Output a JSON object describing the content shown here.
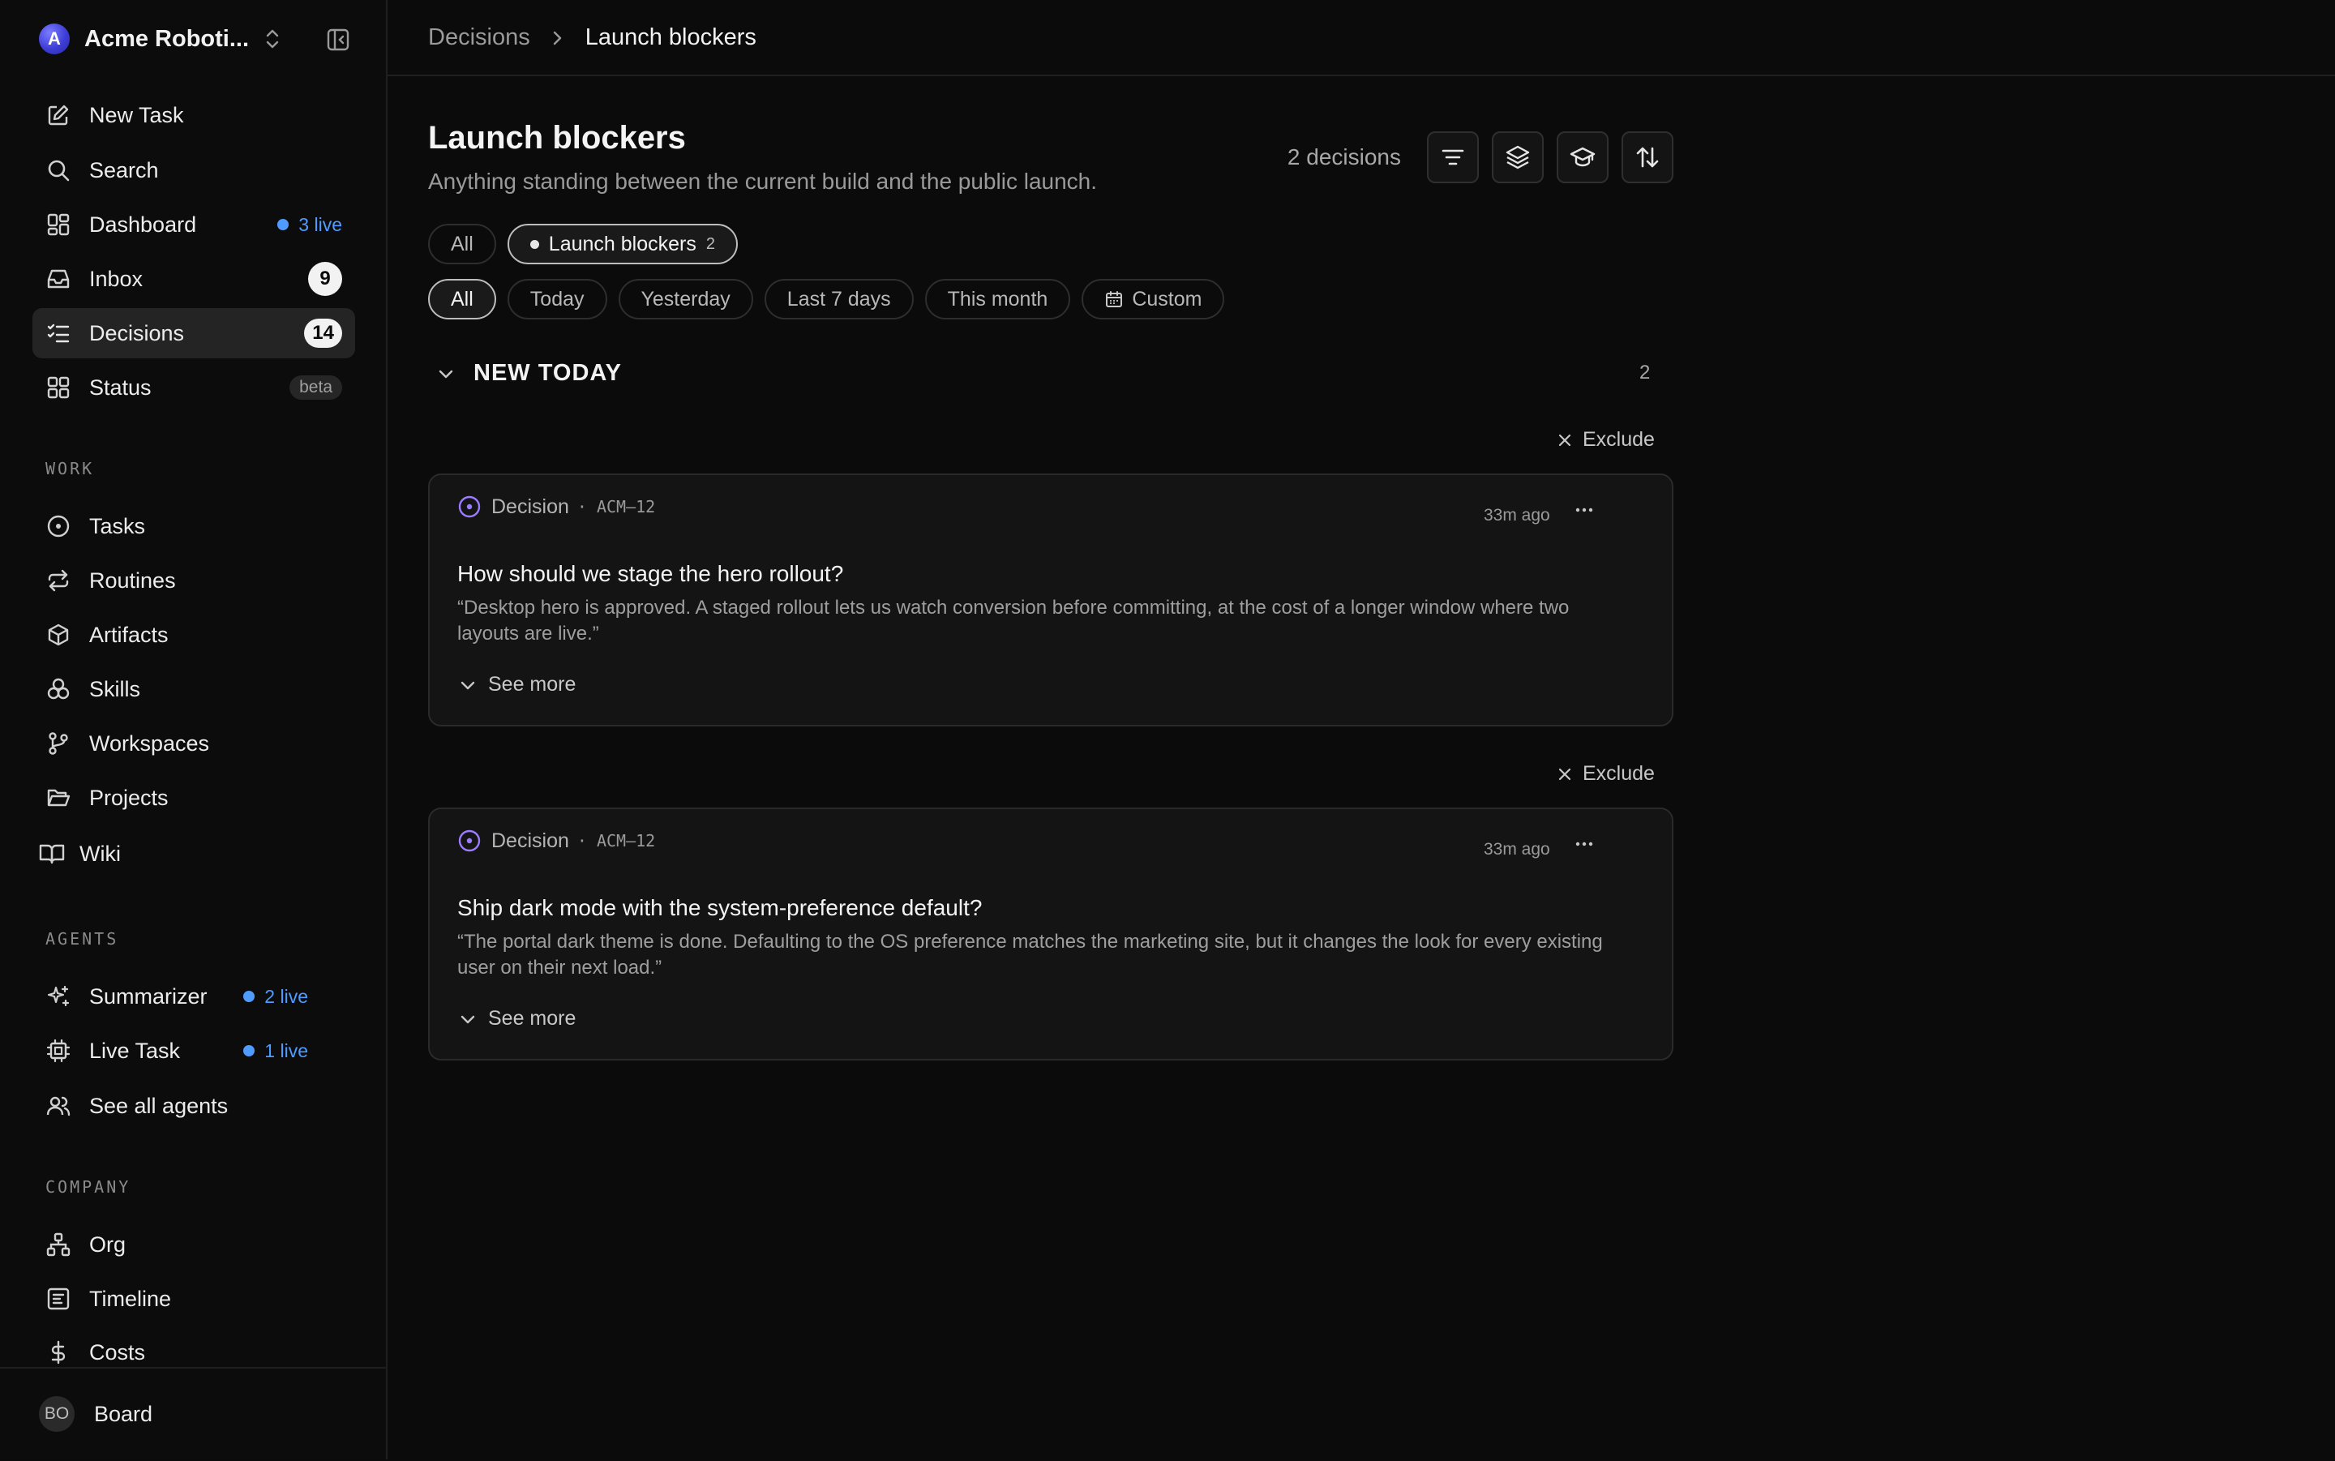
{
  "workspace": {
    "name": "Acme Roboti...",
    "initial": "A"
  },
  "nav": {
    "new_task": "New Task",
    "search": "Search",
    "dashboard": "Dashboard",
    "dashboard_live": "3 live",
    "inbox": "Inbox",
    "inbox_count": "9",
    "decisions": "Decisions",
    "decisions_count": "14",
    "status": "Status",
    "status_tag": "beta"
  },
  "sections": {
    "work": "WORK",
    "agents": "AGENTS",
    "company": "COMPANY"
  },
  "work_items": {
    "tasks": "Tasks",
    "routines": "Routines",
    "artifacts": "Artifacts",
    "skills": "Skills",
    "workspaces": "Workspaces",
    "projects": "Projects",
    "wiki": "Wiki"
  },
  "agents": {
    "summarizer": "Summarizer",
    "summarizer_live": "2 live",
    "live_task": "Live Task",
    "live_task_live": "1 live",
    "see_all": "See all agents"
  },
  "company_items": {
    "org": "Org",
    "timeline": "Timeline",
    "costs": "Costs"
  },
  "user": {
    "initials": "BO",
    "name": "Board"
  },
  "breadcrumb": {
    "parent": "Decisions",
    "current": "Launch blockers"
  },
  "page": {
    "title": "Launch blockers",
    "subtitle": "Anything standing between the current build and the public launch.",
    "count_label": "2 decisions"
  },
  "filters": {
    "scope": {
      "all": "All",
      "launch_blockers": "Launch blockers",
      "launch_blockers_count": "2"
    },
    "time": {
      "all": "All",
      "today": "Today",
      "yesterday": "Yesterday",
      "last7": "Last 7 days",
      "month": "This month",
      "custom": "Custom"
    }
  },
  "group": {
    "title": "NEW TODAY",
    "count": "2"
  },
  "exclude_label": "Exclude",
  "cards": [
    {
      "type": "Decision",
      "id": "· ACM–12",
      "time": "33m ago",
      "title": "How should we stage the hero rollout?",
      "body": "“Desktop hero is approved. A staged rollout lets us watch conversion before committing, at the cost of a longer window where two layouts are live.”",
      "see_more": "See more"
    },
    {
      "type": "Decision",
      "id": "· ACM–12",
      "time": "33m ago",
      "title": "Ship dark mode with the system-preference default?",
      "body": "“The portal dark theme is done. Defaulting to the OS preference matches the marketing site, but it changes the look for every existing user on their next load.”",
      "see_more": "See more"
    }
  ],
  "colors": {
    "accent_live": "#4f9bff",
    "decision_icon": "#9b7cff",
    "background": "#0b0b0b"
  }
}
